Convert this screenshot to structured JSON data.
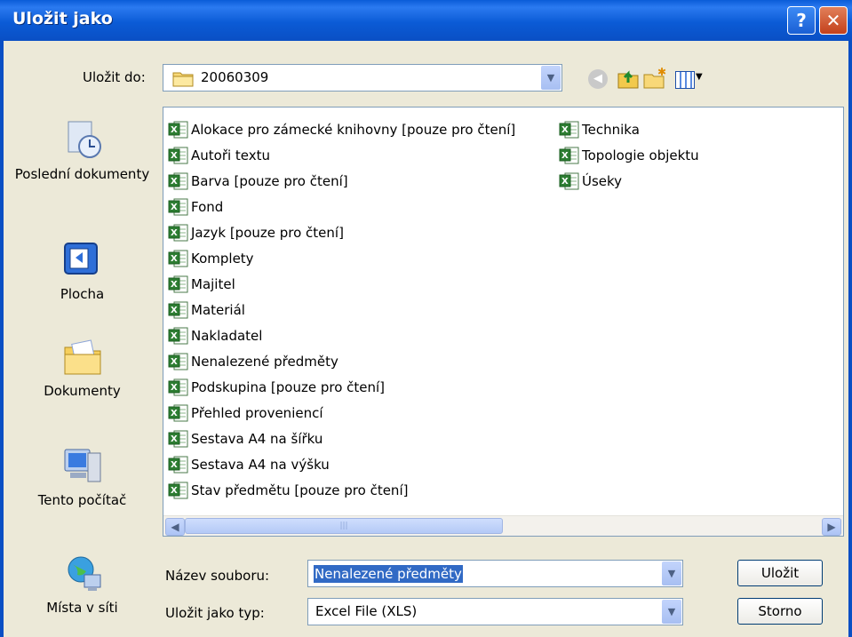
{
  "window": {
    "title": "Uložit jako"
  },
  "toolbar": {
    "save_in_label": "Uložit do:",
    "folder": "20060309"
  },
  "places": [
    {
      "label": "Poslední dokumenty",
      "icon": "recent-documents-icon"
    },
    {
      "label": "Plocha",
      "icon": "desktop-icon"
    },
    {
      "label": "Dokumenty",
      "icon": "my-documents-icon"
    },
    {
      "label": "Tento počítač",
      "icon": "my-computer-icon"
    },
    {
      "label": "Místa v síti",
      "icon": "network-places-icon"
    }
  ],
  "files_col1": [
    "Alokace pro zámecké knihovny [pouze pro čtení]",
    "Autoři textu",
    "Barva [pouze pro čtení]",
    "Fond",
    "Jazyk [pouze pro čtení]",
    "Komplety",
    "Majitel",
    "Materiál",
    "Nakladatel",
    "Nenalezené předměty",
    "Podskupina [pouze pro čtení]",
    "Přehled proveniencí",
    "Sestava A4 na šířku",
    "Sestava A4 na výšku",
    "Stav předmětu [pouze pro čtení]"
  ],
  "files_col2": [
    "Technika",
    "Topologie objektu",
    "Úseky"
  ],
  "filename": {
    "label": "Název souboru:",
    "value": "Nenalezené předměty"
  },
  "filetype": {
    "label": "Uložit jako typ:",
    "value": "Excel File (XLS)"
  },
  "buttons": {
    "save": "Uložit",
    "cancel": "Storno"
  },
  "colors": {
    "title_bar": "#0a5cd8",
    "selection": "#316ac5",
    "dialog_bg": "#ece9d8"
  }
}
